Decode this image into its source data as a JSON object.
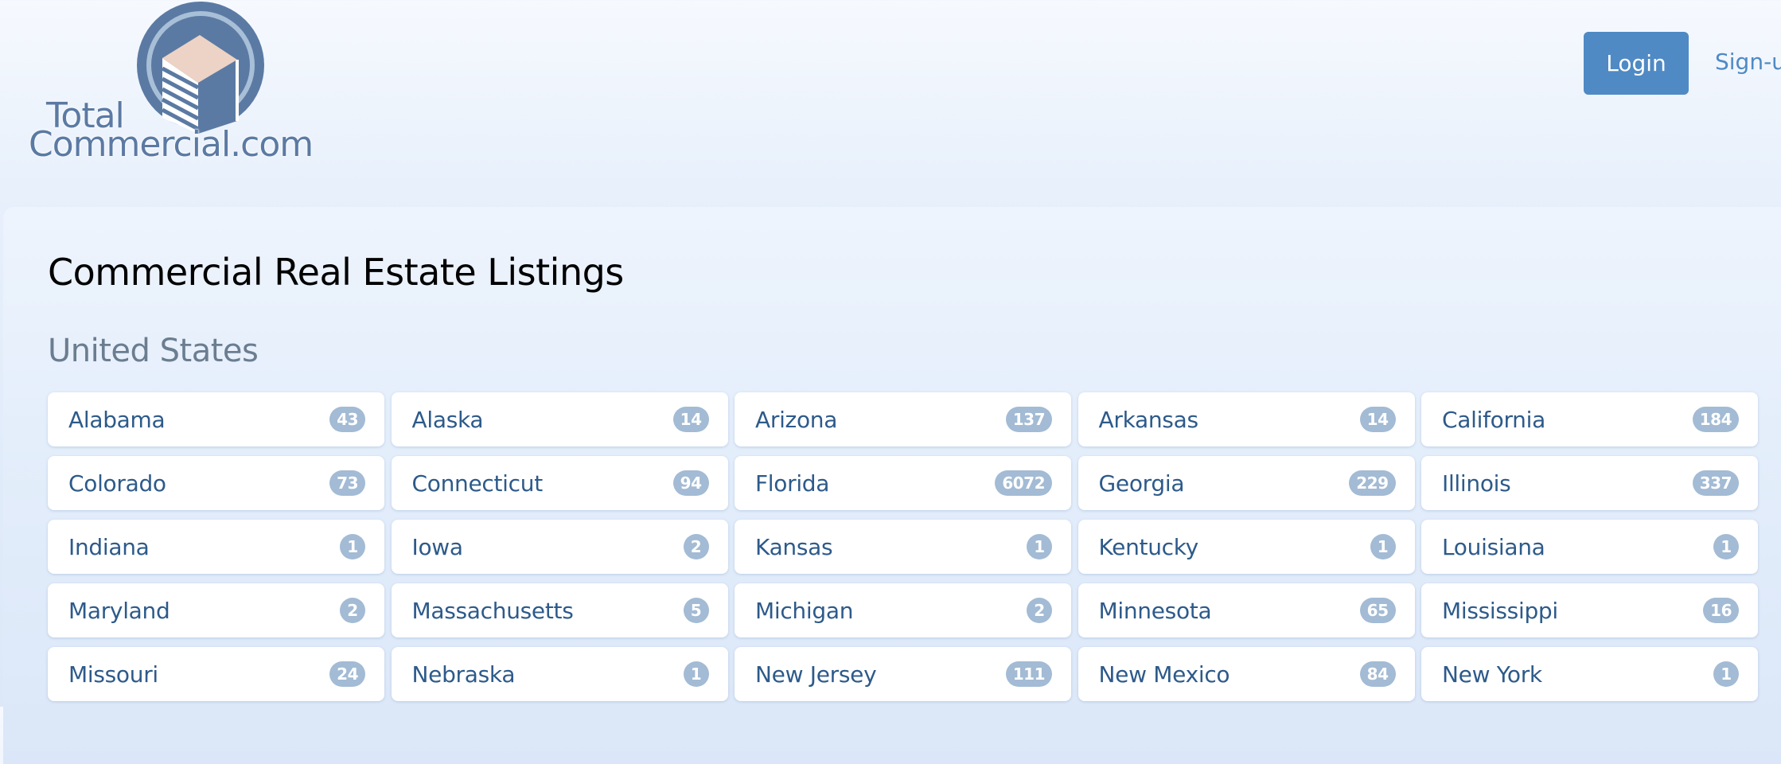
{
  "header": {
    "logo": {
      "line1": "Total",
      "line2": "Commercial.com"
    },
    "login_label": "Login",
    "signup_label": "Sign-u"
  },
  "main": {
    "title": "Commercial Real Estate Listings",
    "section_title": "United States",
    "states": [
      {
        "name": "Alabama",
        "count": "43"
      },
      {
        "name": "Alaska",
        "count": "14"
      },
      {
        "name": "Arizona",
        "count": "137"
      },
      {
        "name": "Arkansas",
        "count": "14"
      },
      {
        "name": "California",
        "count": "184"
      },
      {
        "name": "Colorado",
        "count": "73"
      },
      {
        "name": "Connecticut",
        "count": "94"
      },
      {
        "name": "Florida",
        "count": "6072"
      },
      {
        "name": "Georgia",
        "count": "229"
      },
      {
        "name": "Illinois",
        "count": "337"
      },
      {
        "name": "Indiana",
        "count": "1"
      },
      {
        "name": "Iowa",
        "count": "2"
      },
      {
        "name": "Kansas",
        "count": "1"
      },
      {
        "name": "Kentucky",
        "count": "1"
      },
      {
        "name": "Louisiana",
        "count": "1"
      },
      {
        "name": "Maryland",
        "count": "2"
      },
      {
        "name": "Massachusetts",
        "count": "5"
      },
      {
        "name": "Michigan",
        "count": "2"
      },
      {
        "name": "Minnesota",
        "count": "65"
      },
      {
        "name": "Mississippi",
        "count": "16"
      },
      {
        "name": "Missouri",
        "count": "24"
      },
      {
        "name": "Nebraska",
        "count": "1"
      },
      {
        "name": "New Jersey",
        "count": "111"
      },
      {
        "name": "New Mexico",
        "count": "84"
      },
      {
        "name": "New York",
        "count": "1"
      }
    ]
  },
  "colors": {
    "accent": "#4f8ac4",
    "state_text": "#2d5a8a",
    "badge_bg": "#a3bbd4",
    "section_text": "#6b7d90",
    "logo_blue": "#5b7aa3",
    "logo_roof": "#ecd3c5"
  }
}
